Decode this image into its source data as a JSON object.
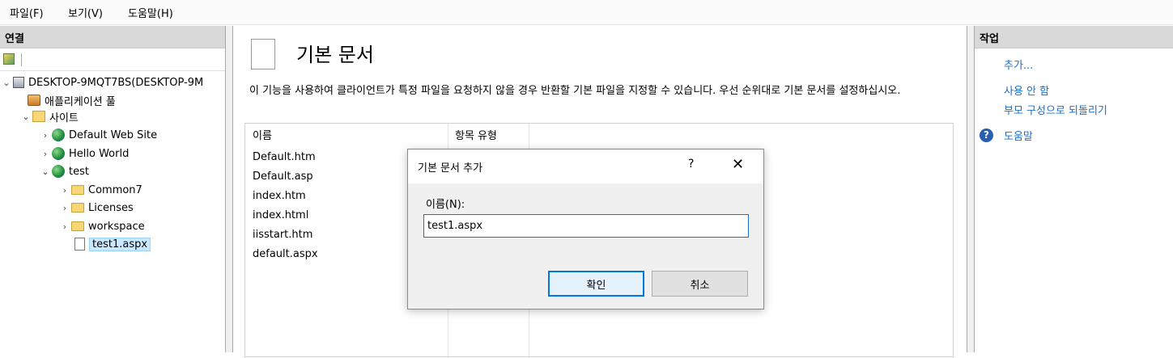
{
  "menubar": {
    "items": [
      "파일(F)",
      "보기(V)",
      "도움말(H)"
    ]
  },
  "connections": {
    "header": "연결",
    "tree": {
      "server": "DESKTOP-9MQT7BS(DESKTOP-9M",
      "app_pools": "애플리케이션 풀",
      "sites": "사이트",
      "site1": "Default Web Site",
      "site2": "Hello World",
      "site3": "test",
      "folder1": "Common7",
      "folder2": "Licenses",
      "folder3": "workspace",
      "file1": "test1.aspx"
    }
  },
  "main": {
    "title": "기본 문서",
    "description": "이 기능을 사용하여 클라이언트가 특정 파일을 요청하지 않을 경우 반환할 기본 파일을 지정할 수 있습니다. 우선 순위대로 기본 문서를 설정하십시오.",
    "columns": [
      "이름",
      "항목 유형"
    ],
    "rows": [
      "Default.htm",
      "Default.asp",
      "index.htm",
      "index.html",
      "iisstart.htm",
      "default.aspx"
    ]
  },
  "actions": {
    "header": "작업",
    "add": "추가...",
    "disable": "사용 안 함",
    "revert": "부모 구성으로 되돌리기",
    "help": "도움말"
  },
  "dialog": {
    "title": "기본 문서 추가",
    "help_glyph": "?",
    "close_glyph": "✕",
    "name_label": "이름(N):",
    "name_value": "test1.aspx",
    "ok": "확인",
    "cancel": "취소"
  }
}
